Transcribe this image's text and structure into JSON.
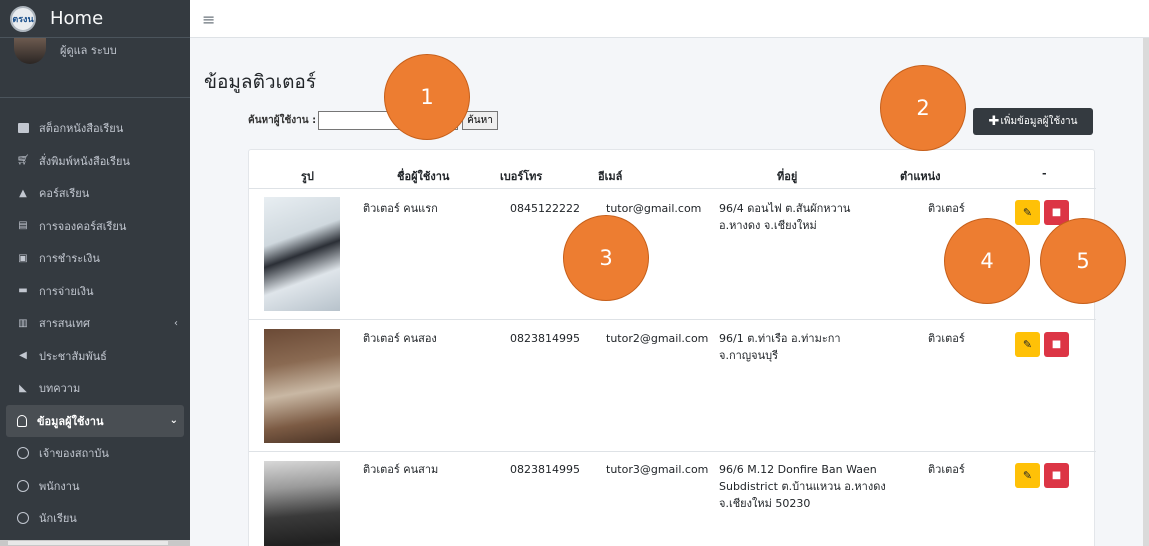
{
  "sidebar": {
    "brand_logo_text": "ตรงน",
    "brand": "Home",
    "user_name": "ผู้ดูแล ระบบ",
    "items": [
      {
        "label": "สต็อกหนังสือเรียน",
        "icon": "inventory-icon"
      },
      {
        "label": "สั่งพิมพ์หนังสือเรียน",
        "icon": "cart-icon"
      },
      {
        "label": "คอร์สเรียน",
        "icon": "graduation-cap-icon"
      },
      {
        "label": "การจองคอร์สเรียน",
        "icon": "document-icon"
      },
      {
        "label": "การชำระเงิน",
        "icon": "money-icon"
      },
      {
        "label": "การจ่ายเงิน",
        "icon": "credit-card-icon"
      },
      {
        "label": "สารสนเทศ",
        "icon": "chart-icon",
        "arrow": "‹"
      },
      {
        "label": "ประชาสัมพันธ์",
        "icon": "megaphone-icon"
      },
      {
        "label": "บทความ",
        "icon": "rss-icon"
      }
    ],
    "active": {
      "label": "ข้อมูลผู้ใช้งาน",
      "arrow": "⌄"
    },
    "sub_items": [
      {
        "label": "เจ้าของสถาบัน"
      },
      {
        "label": "พนักงาน"
      },
      {
        "label": "นักเรียน"
      }
    ]
  },
  "header": {
    "menu_icon": "≡"
  },
  "main": {
    "title": "ข้อมูลติวเตอร์",
    "search_label": "ค้นหาผู้ใช้งาน :",
    "search_value": "",
    "search_button": "ค้นหา",
    "add_button": "เพิ่มข้อมูลผู้ใช้งาน",
    "columns": [
      "รูป",
      "ชื่อผู้ใช้งาน",
      "เบอร์โทร",
      "อีเมล์",
      "ที่อยู่",
      "ตำแหน่ง",
      "-"
    ],
    "rows": [
      {
        "name": "ติวเตอร์ คนแรก",
        "phone": "0845122222",
        "email": "tutor@gmail.com",
        "address": [
          "96/4 ดอนไฟ ต.สันผักหวาน",
          "อ.หางดง จ.เชียงใหม่"
        ],
        "position": "ติวเตอร์"
      },
      {
        "name": "ติวเตอร์ คนสอง",
        "phone": "0823814995",
        "email": "tutor2@gmail.com",
        "address": [
          "96/1 ต.ท่าเรือ อ.ท่ามะกา",
          "จ.กาญจนบุรี"
        ],
        "position": "ติวเตอร์"
      },
      {
        "name": "ติวเตอร์ คนสาม",
        "phone": "0823814995",
        "email": "tutor3@gmail.com",
        "address": [
          "96/6 M.12 Donfire Ban Waen",
          "Subdistrict ต.บ้านแหวน อ.หางดง",
          "จ.เชียงใหม่ 50230"
        ],
        "position": "ติวเตอร์"
      }
    ]
  },
  "callouts": [
    "1",
    "2",
    "3",
    "4",
    "5"
  ],
  "colors": {
    "sidebar": "#343a40",
    "callout": "#ed7d31",
    "edit": "#ffc107",
    "delete": "#dc3545"
  }
}
